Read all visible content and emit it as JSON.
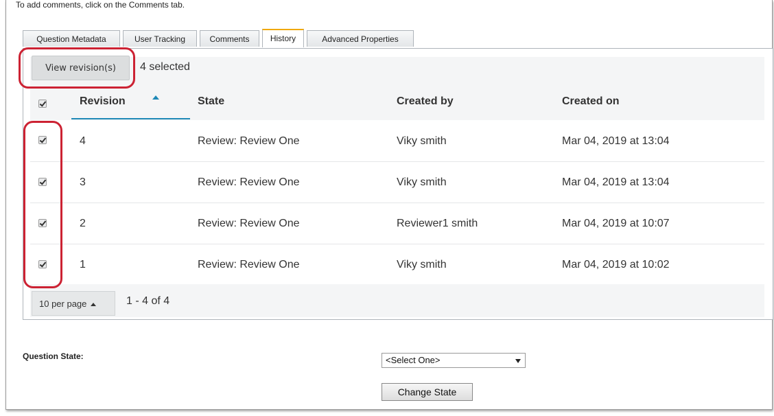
{
  "intro_text": "To add comments, click on the Comments tab.",
  "tabs": [
    {
      "label": "Question Metadata"
    },
    {
      "label": "User Tracking"
    },
    {
      "label": "Comments"
    },
    {
      "label": "History",
      "active": true
    },
    {
      "label": "Advanced Properties"
    }
  ],
  "toolbar": {
    "view_revisions_label": "View revision(s)",
    "selected_count": "4 selected"
  },
  "table": {
    "headers": {
      "revision": "Revision",
      "state": "State",
      "created_by": "Created by",
      "created_on": "Created on"
    },
    "sort_column": "revision",
    "rows": [
      {
        "revision": "4",
        "state": "Review: Review One",
        "created_by": "Viky smith",
        "created_on": "Mar 04, 2019 at 13:04",
        "checked": true
      },
      {
        "revision": "3",
        "state": "Review: Review One",
        "created_by": "Viky smith",
        "created_on": "Mar 04, 2019 at 13:04",
        "checked": true
      },
      {
        "revision": "2",
        "state": "Review: Review One",
        "created_by": "Reviewer1 smith",
        "created_on": "Mar 04, 2019 at 10:07",
        "checked": true
      },
      {
        "revision": "1",
        "state": "Review: Review One",
        "created_by": "Viky smith",
        "created_on": "Mar 04, 2019 at 10:02",
        "checked": true
      }
    ]
  },
  "pagination": {
    "per_page_label": "10 per page",
    "range_label": "1 - 4 of 4"
  },
  "question_state": {
    "label": "Question State:",
    "select_value": "<Select One>",
    "change_button_label": "Change State"
  },
  "colors": {
    "highlight_red": "#cc2233",
    "sort_accent": "#1e88b6",
    "active_tab_accent": "#f0a800"
  }
}
